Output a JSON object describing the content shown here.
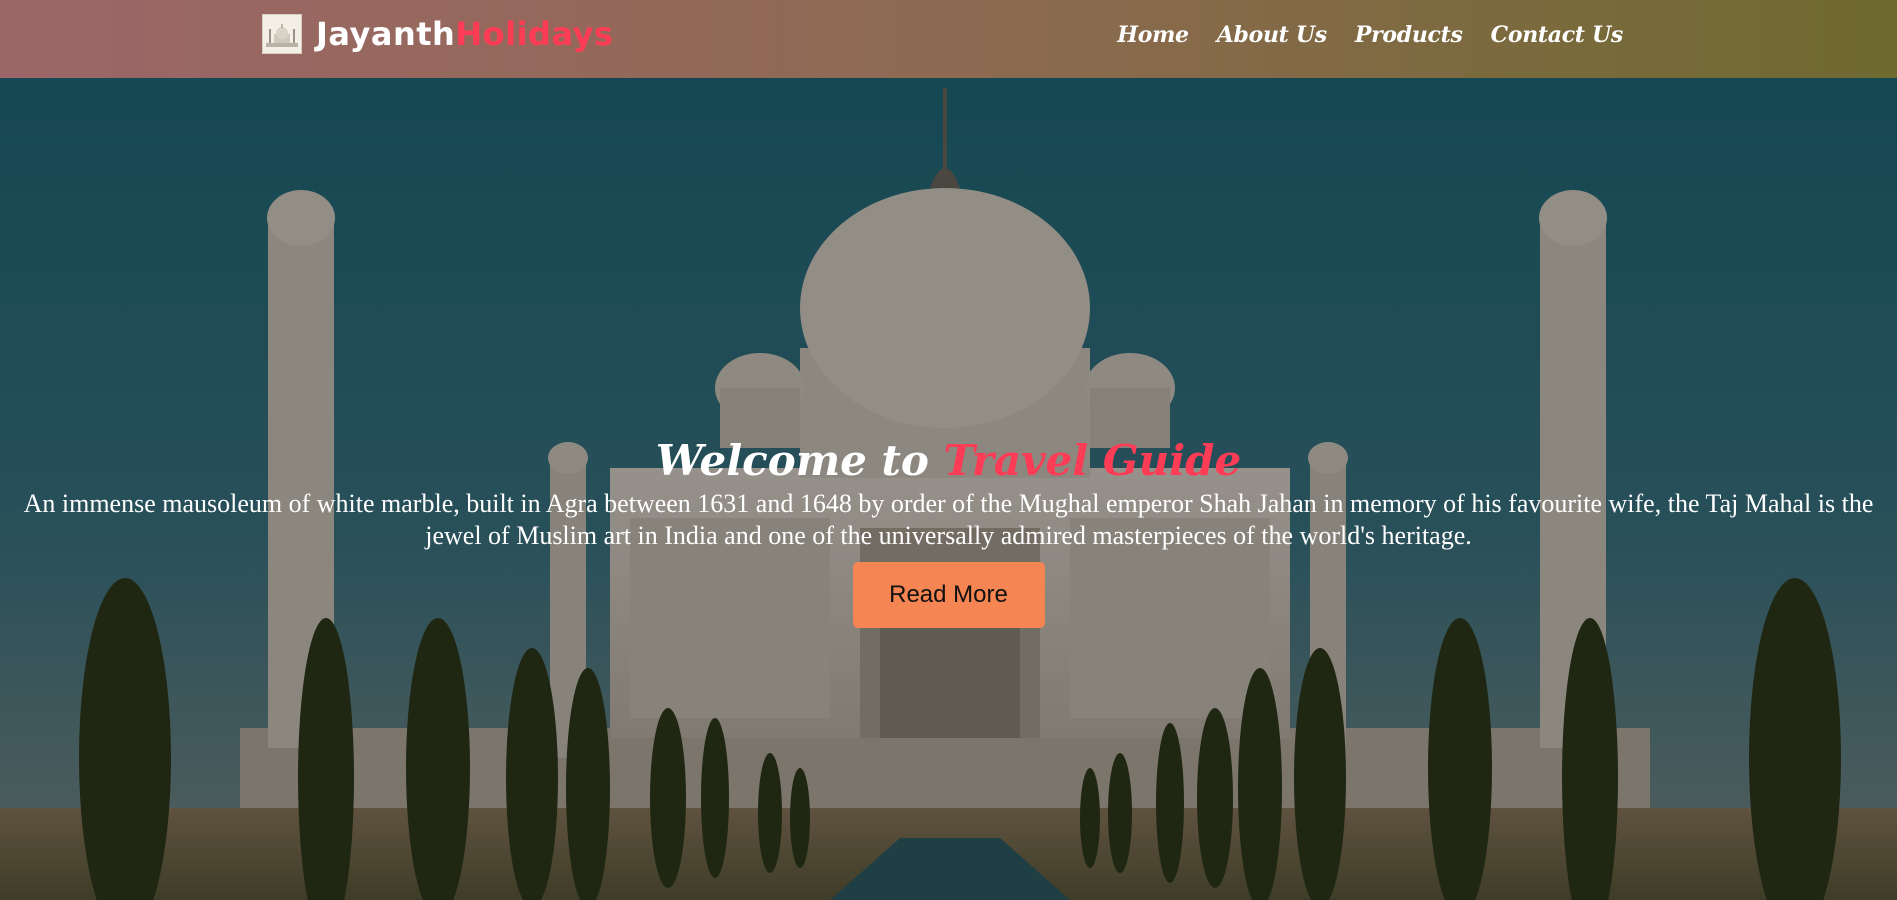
{
  "navbar": {
    "brand_main": "Jayanth",
    "brand_accent": "Holidays",
    "logo_icon": "taj-mahal-logo-icon",
    "links": [
      {
        "label": "Home"
      },
      {
        "label": "About Us"
      },
      {
        "label": "Products"
      },
      {
        "label": "Contact Us"
      }
    ]
  },
  "hero": {
    "title_prefix": "Welcome to ",
    "title_accent": "Travel Guide",
    "description": "An immense mausoleum of white marble, built in Agra between 1631 and 1648 by order of the Mughal emperor Shah Jahan in memory of his favourite wife, the Taj Mahal is the jewel of Muslim art in India and one of the universally admired masterpieces of the world's heritage.",
    "button_label": "Read More",
    "background_image": "taj-mahal-photo"
  },
  "colors": {
    "accent": "#ff3c55",
    "button": "#f58553",
    "nav_gradient_start": "#9c6668",
    "nav_gradient_end": "#6e6a30"
  }
}
